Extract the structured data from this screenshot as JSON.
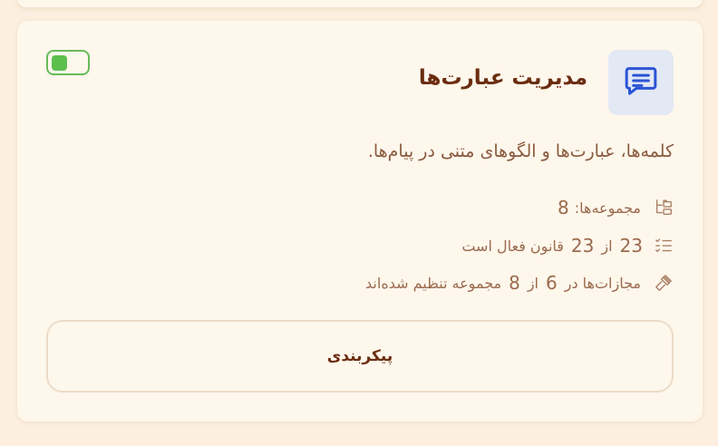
{
  "card": {
    "title": "مدیریت عبارت‌ها",
    "icon": "message-lines-icon",
    "enabled": true,
    "description": "کلمه‌ها، عبارت‌ها و الگوهای متنی در پیام‌ها.",
    "stats": {
      "collections": {
        "label": "مجموعه‌ها:",
        "value": "8",
        "icon": "folder-tree-icon"
      },
      "rules": {
        "active": "23",
        "sep": "از",
        "total": "23",
        "suffix": "قانون فعال است",
        "icon": "checklist-icon"
      },
      "punishments": {
        "prefix": "مجازات‌ها در",
        "configured": "6",
        "sep": "از",
        "total": "8",
        "suffix": "مجموعه تنظیم شده‌اند",
        "icon": "gavel-icon"
      }
    },
    "configure_label": "پیکربندی"
  },
  "colors": {
    "title": "#6b2d10",
    "toggle_on": "#5cbf4e",
    "icon_accent": "#2b54d6",
    "icon_bg": "#e2e8f4"
  }
}
